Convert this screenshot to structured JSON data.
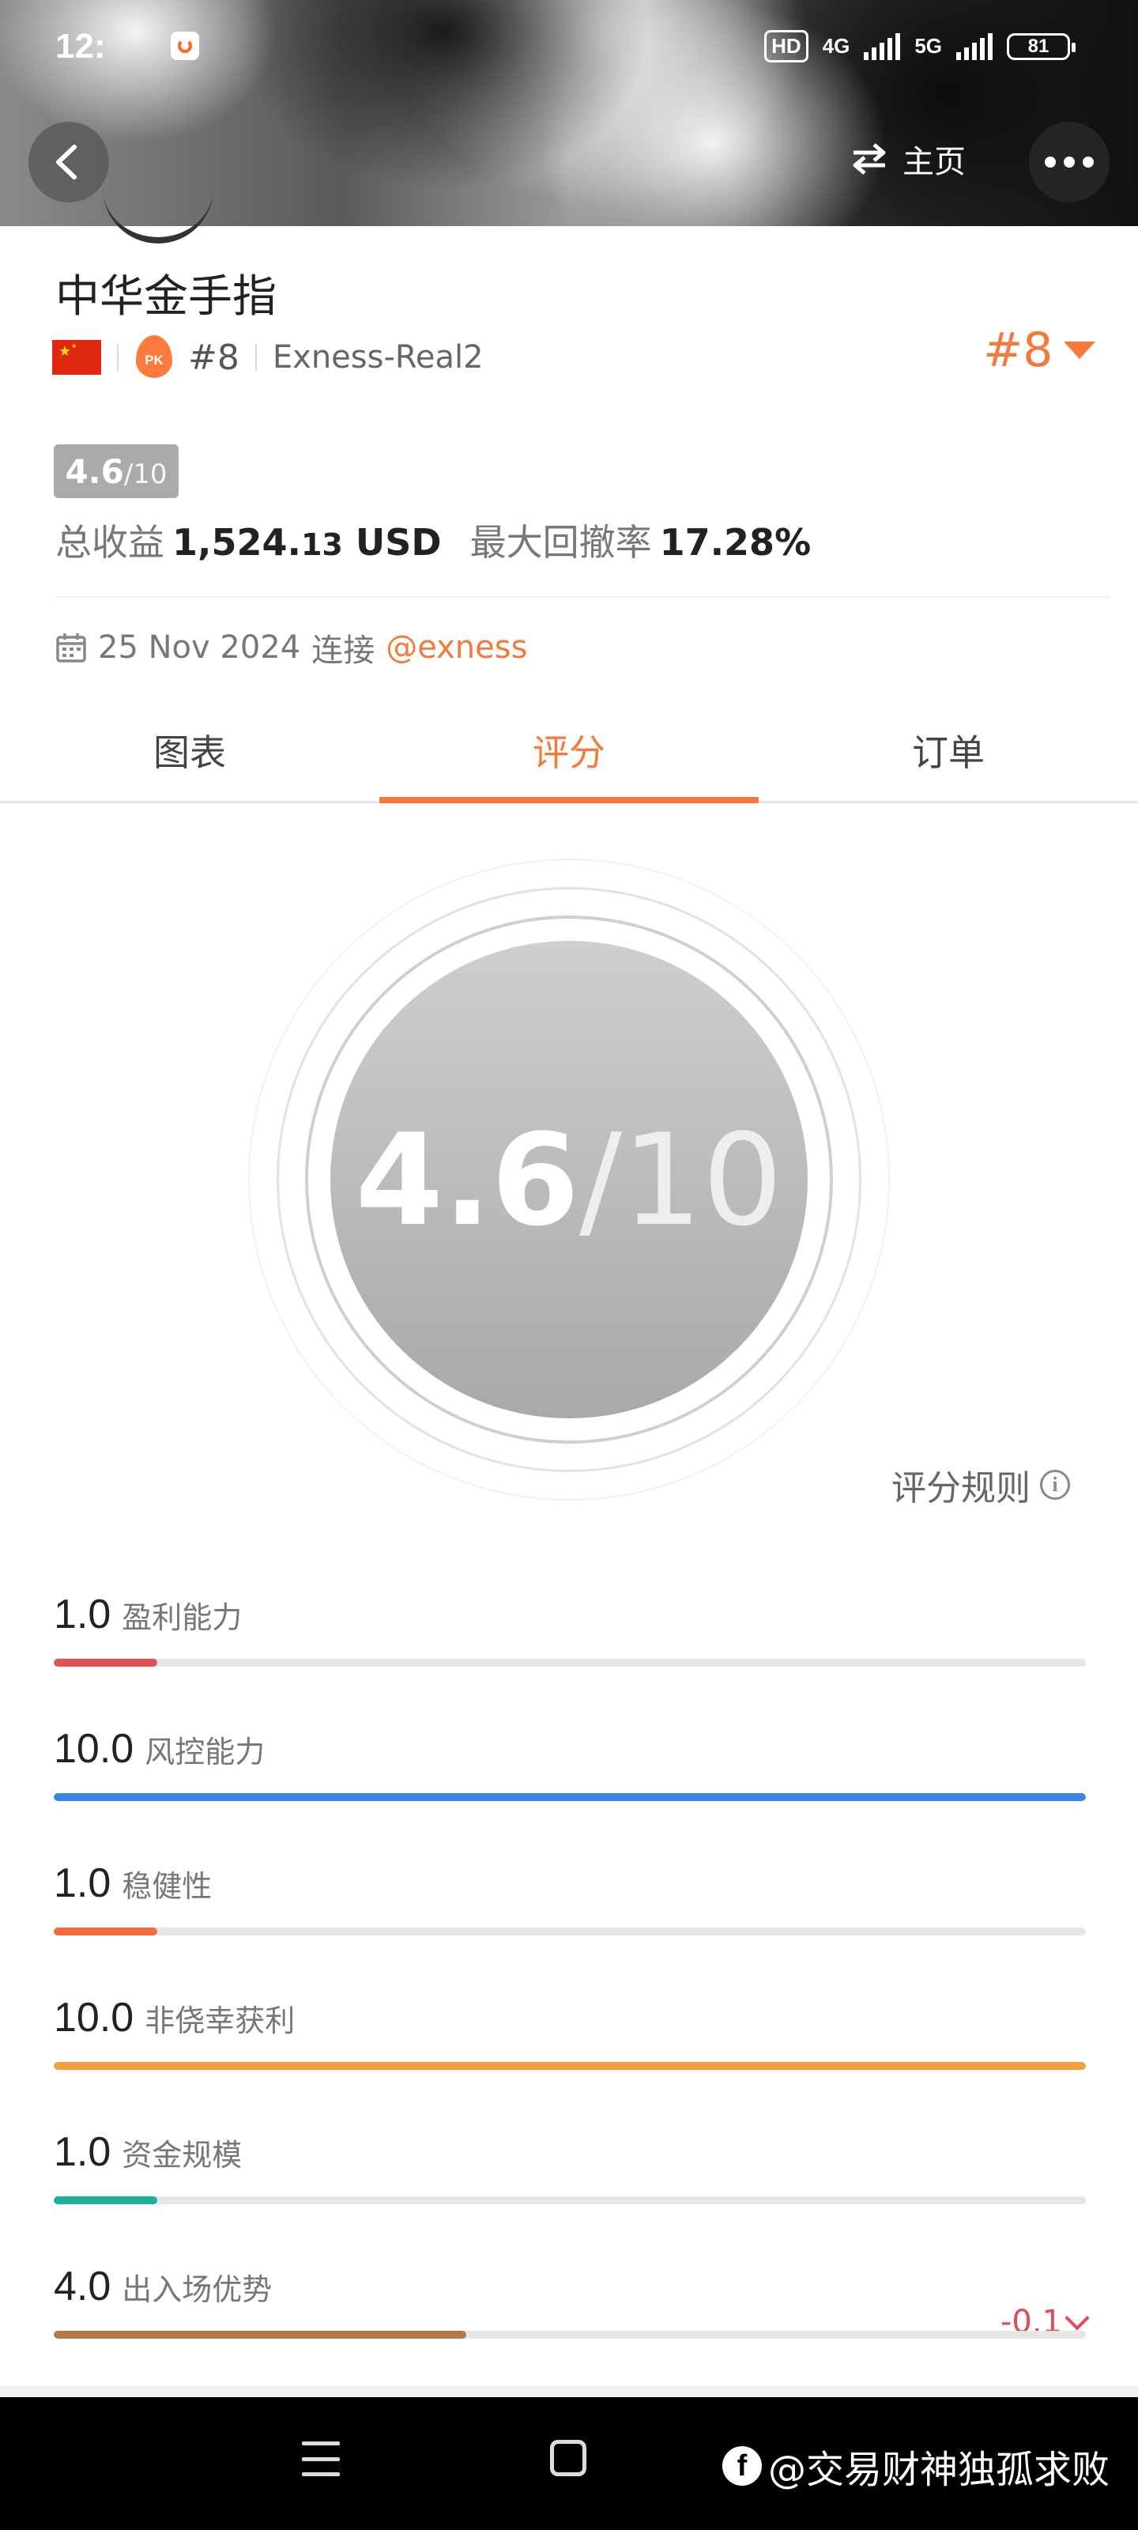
{
  "status_bar": {
    "time": "12:",
    "hd": "HD",
    "net1": "4G",
    "net2": "5G",
    "battery": "81"
  },
  "header": {
    "home_label": "主页"
  },
  "profile": {
    "name": "中华金手指",
    "rank": "#8",
    "broker": "Exness-Real2",
    "rank_big": "#8",
    "pk_badge": "PK",
    "score_badge_value": "4.6",
    "score_badge_total": "/10",
    "profit_label": "总收益",
    "profit_value_int": "1,524.",
    "profit_value_dec": "13",
    "profit_unit": "USD",
    "drawdown_label": "最大回撤率",
    "drawdown_value": "17.28%",
    "connected_date": "25 Nov 2024",
    "connected_label": "连接",
    "connected_via": "@exness"
  },
  "tabs": [
    {
      "label": "图表",
      "active": false
    },
    {
      "label": "评分",
      "active": true
    },
    {
      "label": "订单",
      "active": false
    }
  ],
  "gauge": {
    "score": "4.6",
    "total": "/10"
  },
  "rules_label": "评分规则",
  "metrics": [
    {
      "score": "1.0",
      "label": "盈利能力",
      "fraction": 0.1,
      "color": "#e05252"
    },
    {
      "score": "10.0",
      "label": "风控能力",
      "fraction": 1.0,
      "color": "#3b86e0"
    },
    {
      "score": "1.0",
      "label": "稳健性",
      "fraction": 0.1,
      "color": "#f26b3a"
    },
    {
      "score": "10.0",
      "label": "非侥幸获利",
      "fraction": 1.0,
      "color": "#f0a040"
    },
    {
      "score": "1.0",
      "label": "资金规模",
      "fraction": 0.1,
      "color": "#1fae98"
    },
    {
      "score": "4.0",
      "label": "出入场优势",
      "fraction": 0.4,
      "color": "#b27a4a",
      "delta": "-0.1"
    }
  ],
  "watermark": "@交易财神独孤求败",
  "icons": {
    "back": "chevron-left-icon",
    "swap": "swap-arrows-icon",
    "more": "more-dots-icon",
    "calendar": "calendar-icon",
    "info": "info-icon",
    "dropdown": "triangle-down-icon"
  },
  "colors": {
    "accent": "#f47a3c",
    "negative": "#e04a5a"
  }
}
